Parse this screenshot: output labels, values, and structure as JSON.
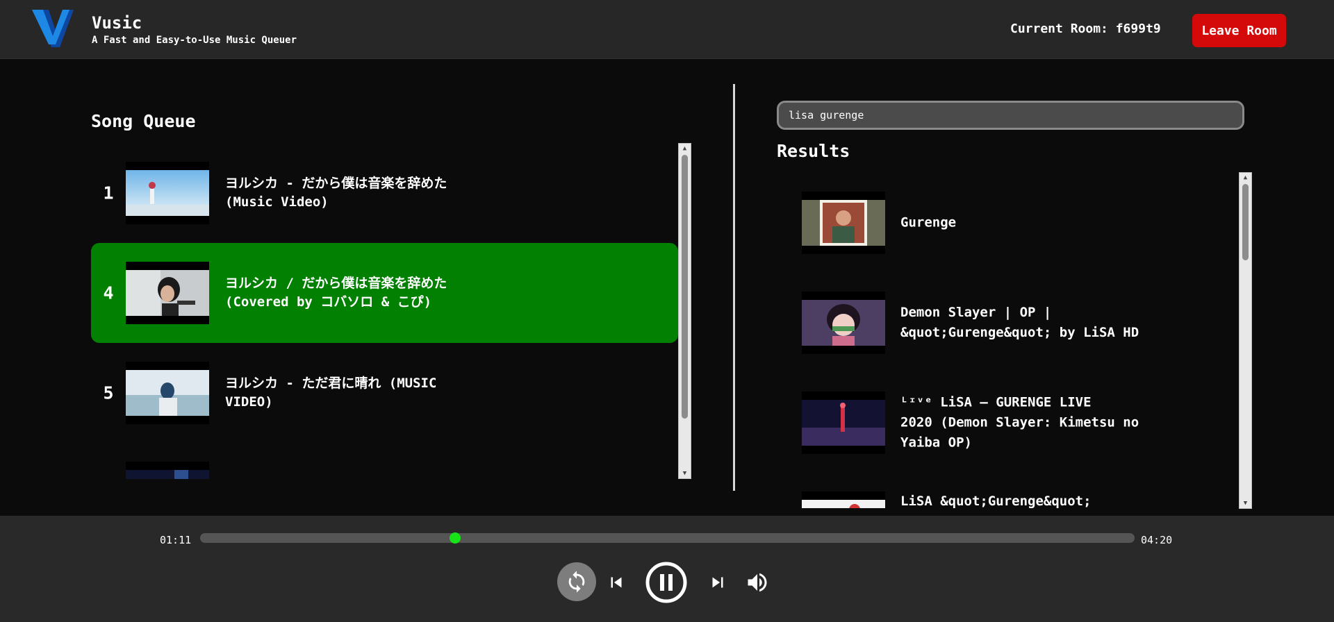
{
  "header": {
    "app_title": "Vusic",
    "app_subtitle": "A Fast and Easy-to-Use Music Queuer",
    "room_label": "Current Room: f699t9",
    "leave_button": "Leave Room",
    "logo_icon": "vusic-v-logo"
  },
  "queue": {
    "heading": "Song Queue",
    "items": [
      {
        "number": "1",
        "title": "ヨルシカ - だから僕は音楽を辞めた\n(Music Video)",
        "active": false
      },
      {
        "number": "4",
        "title": "ヨルシカ / だから僕は音楽を辞めた\n(Covered by コバソロ & こぴ)",
        "active": true
      },
      {
        "number": "5",
        "title": "ヨルシカ - ただ君に晴れ (MUSIC\nVIDEO)",
        "active": false
      }
    ]
  },
  "search": {
    "value": "lisa gurenge",
    "results_heading": "Results",
    "results": [
      {
        "title": "Gurenge"
      },
      {
        "title": "Demon Slayer | OP |\n&quot;Gurenge&quot; by LiSA HD"
      },
      {
        "title": "ᴸᶦᵛᵉ LiSA – GURENGE LIVE\n2020 (Demon Slayer: Kimetsu no\nYaiba OP)"
      },
      {
        "title": "LiSA &quot;Gurenge&quot;"
      }
    ]
  },
  "player": {
    "current_time": "01:11",
    "total_time": "04:20",
    "progress": 0.27,
    "controls": [
      "repeat-icon",
      "skip-previous-icon",
      "pause-icon",
      "skip-next-icon",
      "volume-icon"
    ]
  },
  "colors": {
    "active_queue_item": "#028002",
    "leave_button": "#d40a0a",
    "progress_knob": "#17e317",
    "logo": "#1e88e5"
  }
}
